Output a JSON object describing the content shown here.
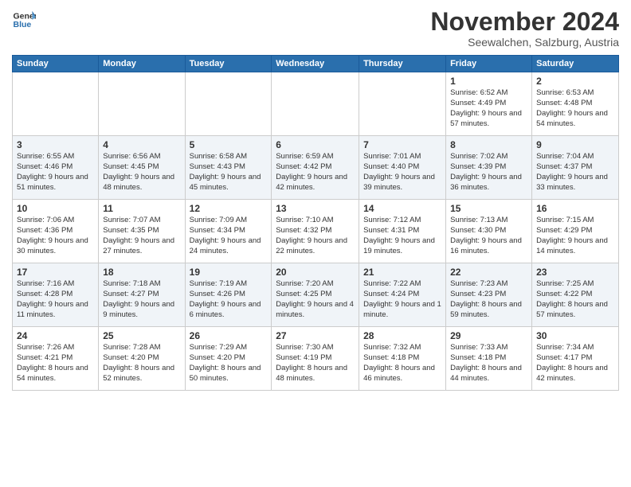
{
  "logo": {
    "line1": "General",
    "line2": "Blue"
  },
  "header": {
    "month": "November 2024",
    "location": "Seewalchen, Salzburg, Austria"
  },
  "days_of_week": [
    "Sunday",
    "Monday",
    "Tuesday",
    "Wednesday",
    "Thursday",
    "Friday",
    "Saturday"
  ],
  "weeks": [
    [
      {
        "day": "",
        "info": ""
      },
      {
        "day": "",
        "info": ""
      },
      {
        "day": "",
        "info": ""
      },
      {
        "day": "",
        "info": ""
      },
      {
        "day": "",
        "info": ""
      },
      {
        "day": "1",
        "info": "Sunrise: 6:52 AM\nSunset: 4:49 PM\nDaylight: 9 hours and 57 minutes."
      },
      {
        "day": "2",
        "info": "Sunrise: 6:53 AM\nSunset: 4:48 PM\nDaylight: 9 hours and 54 minutes."
      }
    ],
    [
      {
        "day": "3",
        "info": "Sunrise: 6:55 AM\nSunset: 4:46 PM\nDaylight: 9 hours and 51 minutes."
      },
      {
        "day": "4",
        "info": "Sunrise: 6:56 AM\nSunset: 4:45 PM\nDaylight: 9 hours and 48 minutes."
      },
      {
        "day": "5",
        "info": "Sunrise: 6:58 AM\nSunset: 4:43 PM\nDaylight: 9 hours and 45 minutes."
      },
      {
        "day": "6",
        "info": "Sunrise: 6:59 AM\nSunset: 4:42 PM\nDaylight: 9 hours and 42 minutes."
      },
      {
        "day": "7",
        "info": "Sunrise: 7:01 AM\nSunset: 4:40 PM\nDaylight: 9 hours and 39 minutes."
      },
      {
        "day": "8",
        "info": "Sunrise: 7:02 AM\nSunset: 4:39 PM\nDaylight: 9 hours and 36 minutes."
      },
      {
        "day": "9",
        "info": "Sunrise: 7:04 AM\nSunset: 4:37 PM\nDaylight: 9 hours and 33 minutes."
      }
    ],
    [
      {
        "day": "10",
        "info": "Sunrise: 7:06 AM\nSunset: 4:36 PM\nDaylight: 9 hours and 30 minutes."
      },
      {
        "day": "11",
        "info": "Sunrise: 7:07 AM\nSunset: 4:35 PM\nDaylight: 9 hours and 27 minutes."
      },
      {
        "day": "12",
        "info": "Sunrise: 7:09 AM\nSunset: 4:34 PM\nDaylight: 9 hours and 24 minutes."
      },
      {
        "day": "13",
        "info": "Sunrise: 7:10 AM\nSunset: 4:32 PM\nDaylight: 9 hours and 22 minutes."
      },
      {
        "day": "14",
        "info": "Sunrise: 7:12 AM\nSunset: 4:31 PM\nDaylight: 9 hours and 19 minutes."
      },
      {
        "day": "15",
        "info": "Sunrise: 7:13 AM\nSunset: 4:30 PM\nDaylight: 9 hours and 16 minutes."
      },
      {
        "day": "16",
        "info": "Sunrise: 7:15 AM\nSunset: 4:29 PM\nDaylight: 9 hours and 14 minutes."
      }
    ],
    [
      {
        "day": "17",
        "info": "Sunrise: 7:16 AM\nSunset: 4:28 PM\nDaylight: 9 hours and 11 minutes."
      },
      {
        "day": "18",
        "info": "Sunrise: 7:18 AM\nSunset: 4:27 PM\nDaylight: 9 hours and 9 minutes."
      },
      {
        "day": "19",
        "info": "Sunrise: 7:19 AM\nSunset: 4:26 PM\nDaylight: 9 hours and 6 minutes."
      },
      {
        "day": "20",
        "info": "Sunrise: 7:20 AM\nSunset: 4:25 PM\nDaylight: 9 hours and 4 minutes."
      },
      {
        "day": "21",
        "info": "Sunrise: 7:22 AM\nSunset: 4:24 PM\nDaylight: 9 hours and 1 minute."
      },
      {
        "day": "22",
        "info": "Sunrise: 7:23 AM\nSunset: 4:23 PM\nDaylight: 8 hours and 59 minutes."
      },
      {
        "day": "23",
        "info": "Sunrise: 7:25 AM\nSunset: 4:22 PM\nDaylight: 8 hours and 57 minutes."
      }
    ],
    [
      {
        "day": "24",
        "info": "Sunrise: 7:26 AM\nSunset: 4:21 PM\nDaylight: 8 hours and 54 minutes."
      },
      {
        "day": "25",
        "info": "Sunrise: 7:28 AM\nSunset: 4:20 PM\nDaylight: 8 hours and 52 minutes."
      },
      {
        "day": "26",
        "info": "Sunrise: 7:29 AM\nSunset: 4:20 PM\nDaylight: 8 hours and 50 minutes."
      },
      {
        "day": "27",
        "info": "Sunrise: 7:30 AM\nSunset: 4:19 PM\nDaylight: 8 hours and 48 minutes."
      },
      {
        "day": "28",
        "info": "Sunrise: 7:32 AM\nSunset: 4:18 PM\nDaylight: 8 hours and 46 minutes."
      },
      {
        "day": "29",
        "info": "Sunrise: 7:33 AM\nSunset: 4:18 PM\nDaylight: 8 hours and 44 minutes."
      },
      {
        "day": "30",
        "info": "Sunrise: 7:34 AM\nSunset: 4:17 PM\nDaylight: 8 hours and 42 minutes."
      }
    ]
  ]
}
